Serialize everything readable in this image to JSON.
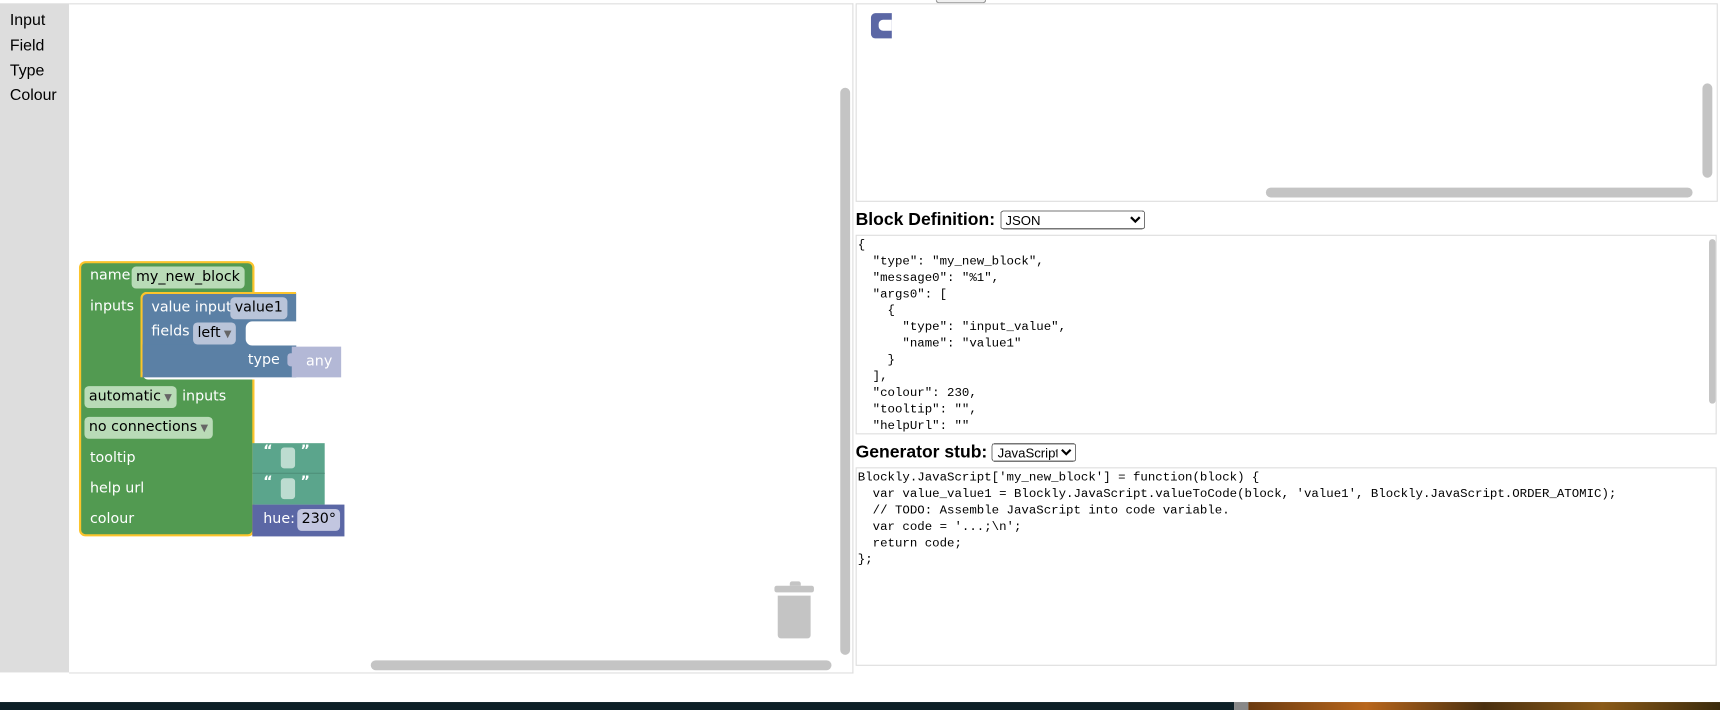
{
  "toolbox": {
    "items": [
      "Input",
      "Field",
      "Type",
      "Colour"
    ]
  },
  "factory_block": {
    "name_label": "name",
    "name_value": "my_new_block",
    "inputs_label": "inputs",
    "value_input_label": "value input",
    "value_input_name": "value1",
    "fields_label": "fields",
    "fields_align": "left",
    "type_label": "type",
    "type_value": "any",
    "inputs_mode": "automatic",
    "inputs_mode_suffix": "inputs",
    "connections": "no connections",
    "tooltip_label": "tooltip",
    "helpurl_label": "help url",
    "colour_label": "colour",
    "open_quote": "“",
    "close_quote": "”",
    "hue_label": "hue:",
    "hue_value": "230°"
  },
  "colors": {
    "green": "#529a51",
    "blue": "#5b80a5",
    "teal": "#5ba58c",
    "purple": "#5b67a5",
    "lavender": "#b3b8d6",
    "selected": "#fcc42b"
  },
  "block_definition": {
    "label": "Block Definition:",
    "format": "JSON",
    "code": "{\n  \"type\": \"my_new_block\",\n  \"message0\": \"%1\",\n  \"args0\": [\n    {\n      \"type\": \"input_value\",\n      \"name\": \"value1\"\n    }\n  ],\n  \"colour\": 230,\n  \"tooltip\": \"\",\n  \"helpUrl\": \"\"\n}"
  },
  "generator_stub": {
    "label": "Generator stub:",
    "language": "JavaScript",
    "code": "Blockly.JavaScript['my_new_block'] = function(block) {\n  var value_value1 = Blockly.JavaScript.valueToCode(block, 'value1', Blockly.JavaScript.ORDER_ATOMIC);\n  // TODO: Assemble JavaScript into code variable.\n  var code = '...;\\n';\n  return code;\n};"
  }
}
